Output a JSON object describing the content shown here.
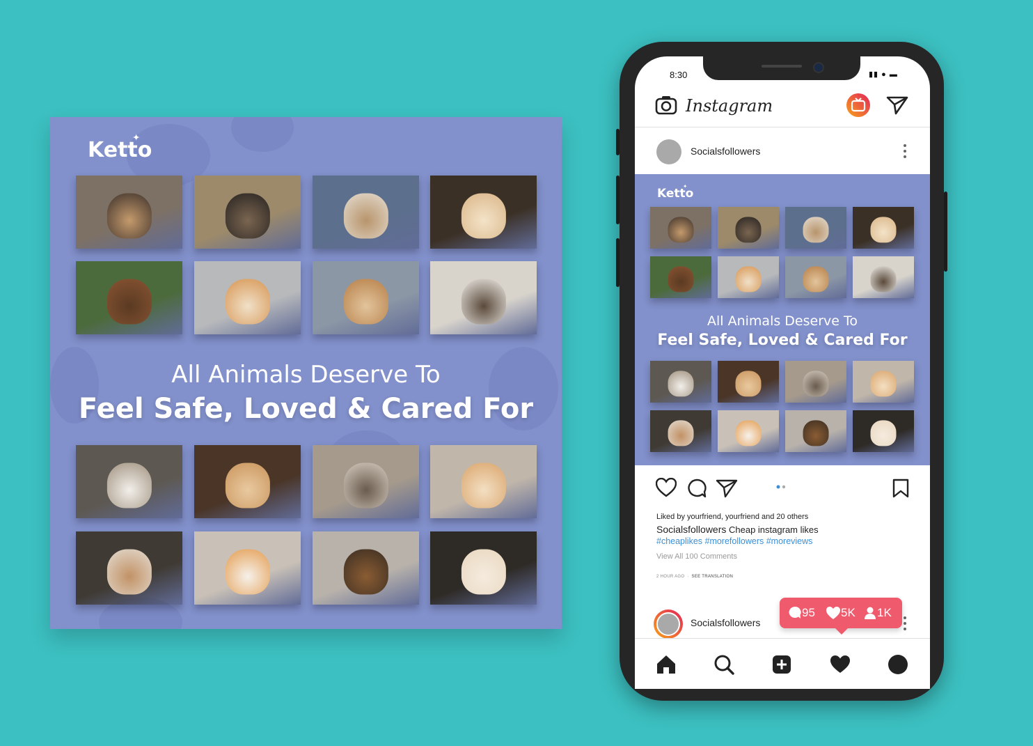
{
  "poster": {
    "brand": "Ketto",
    "headline_line1": "All Animals Deserve To",
    "headline_line2": "Feel Safe, Loved & Cared For",
    "bg_color": "#8290cb"
  },
  "phone": {
    "time": "8:30",
    "app_name": "Instagram",
    "post": {
      "username": "Socialsfollowers",
      "brand": "Ketto",
      "headline_line1": "All Animals Deserve To",
      "headline_line2": "Feel Safe, Loved & Cared For",
      "liked_by": "Liked by yourfriend, yourfriend and 20 others",
      "caption_user": "Socialsfollowers",
      "caption_text": "Cheap instagram likes",
      "hashtags": "#cheaplikes #morefollowers #moreviews",
      "view_comments": "View All 100 Comments",
      "time_ago": "2 HOUR AGO",
      "see_translation": "SEE TRANSLATION"
    },
    "next_post": {
      "username": "Socialsfollowers"
    },
    "notification": {
      "comments": "95",
      "likes": "5K",
      "followers": "1K"
    }
  }
}
